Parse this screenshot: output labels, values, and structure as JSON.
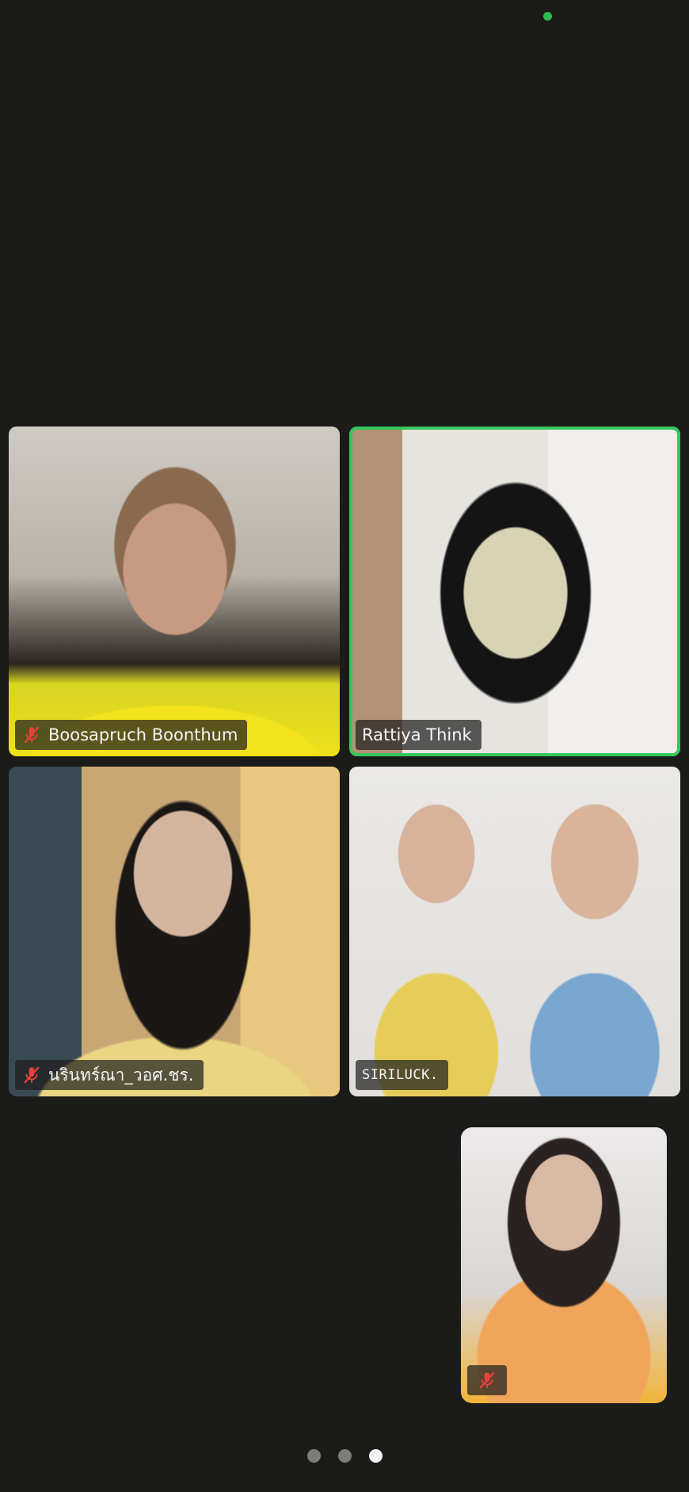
{
  "participants": [
    {
      "name": "Boosapruch Boonthum",
      "muted": true,
      "active_speaker": false
    },
    {
      "name": "Rattiya Think",
      "muted": false,
      "active_speaker": true
    },
    {
      "name": "นรินทร์ณา_วอศ.ชร.",
      "muted": true,
      "active_speaker": false
    },
    {
      "name": "SIRILUCK.",
      "muted": false,
      "active_speaker": false
    }
  ],
  "self_view": {
    "muted": true
  },
  "pager": {
    "total": 3,
    "current": 3
  },
  "colors": {
    "background": "#1b1b19",
    "active_speaker_border": "#35c75a",
    "muted_icon": "#e8423b",
    "status_dot": "#2dbd4e"
  },
  "icons": {
    "muted": "mic-off-icon",
    "status": "status-dot"
  }
}
